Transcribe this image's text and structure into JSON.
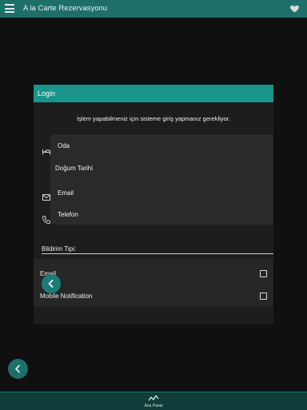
{
  "app": {
    "title": "A la Carte Rezervasyonu"
  },
  "dialog": {
    "title": "Login",
    "message": "İşlem yapabilmeniz için sisteme giriş yapmanız gerekliyor.",
    "fields": {
      "room": "Oda",
      "birthdate": "Doğum Tarihi",
      "email": "Email",
      "phone": "Telefon"
    },
    "notification": {
      "label": "Bildirim Tipi:",
      "options": [
        "Email",
        "Mobile Notification"
      ]
    }
  },
  "bottom_nav": {
    "label": "Ana Panel"
  },
  "colors": {
    "appbar": "#1e6f6a",
    "dialog_header": "#1a948b",
    "accent": "#1a7e77"
  }
}
